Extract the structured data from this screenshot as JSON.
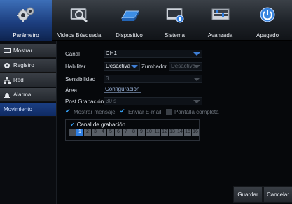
{
  "menu": {
    "tabs": [
      {
        "label": "Parámetro",
        "icon": "gears-icon",
        "active": true
      },
      {
        "label": "Videos Búsqueda",
        "icon": "search-video-icon",
        "active": false
      },
      {
        "label": "Dispositivo",
        "icon": "hard-disk-icon",
        "active": false
      },
      {
        "label": "Sistema",
        "icon": "system-info-icon",
        "active": false
      },
      {
        "label": "Avanzada",
        "icon": "advanced-settings-icon",
        "active": false
      },
      {
        "label": "Apagado",
        "icon": "power-icon",
        "active": false
      }
    ]
  },
  "sidebar": {
    "items": [
      {
        "label": "Mostrar",
        "icon": "monitor-icon",
        "active": false
      },
      {
        "label": "Registro",
        "icon": "record-settings-icon",
        "active": false
      },
      {
        "label": "Red",
        "icon": "network-icon",
        "active": false
      },
      {
        "label": "Alarma",
        "icon": "alarm-bell-icon",
        "active": false
      },
      {
        "label": "Movimiento",
        "icon": "",
        "active": true
      }
    ]
  },
  "form": {
    "canal_label": "Canal",
    "canal_value": "CH1",
    "habilitar_label": "Habilitar",
    "habilitar_value": "Desactiva",
    "zumbador_label": "Zumbador",
    "zumbador_value": "Desactiva",
    "sensibilidad_label": "Sensibilidad",
    "sensibilidad_value": "3",
    "area_label": "Área",
    "area_button": "Configuración",
    "post_label": "Post Grabación",
    "post_value": "30 s",
    "mostrar_mensaje": "Mostrar mensaje",
    "enviar_email": "Enviar E-mail",
    "pantalla_completa": "Pantalla completa",
    "canal_grabacion": "Canal de grabación",
    "channels": [
      "1",
      "2",
      "3",
      "4",
      "5",
      "6",
      "7",
      "8",
      "9",
      "10",
      "11",
      "12",
      "13",
      "14",
      "15",
      "16"
    ]
  },
  "buttons": {
    "guardar": "Guardar",
    "cancelar": "Cancelar"
  },
  "colors": {
    "accent_blue": "#2f7fe3",
    "active_tab": "#1d3f80"
  }
}
